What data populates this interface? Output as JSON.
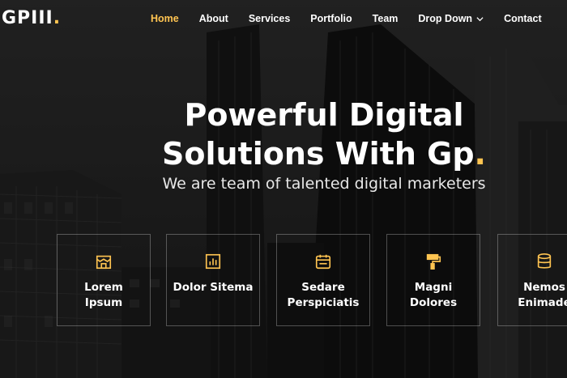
{
  "header": {
    "logo_text": "GPIII",
    "logo_dot": ".",
    "accent_color": "#ffc451",
    "nav": [
      {
        "label": "Home",
        "active": true
      },
      {
        "label": "About"
      },
      {
        "label": "Services"
      },
      {
        "label": "Portfolio"
      },
      {
        "label": "Team"
      },
      {
        "label": "Drop Down",
        "icon": "chevron-down-icon"
      },
      {
        "label": "Contact"
      }
    ]
  },
  "hero": {
    "title_line1": "Powerful Digital",
    "title_line2": "Solutions With Gp",
    "title_dot": ".",
    "subtitle": "We are team of talented digital marketers"
  },
  "features": [
    {
      "title_line1": "Lorem",
      "title_line2": "Ipsum",
      "icon": "store-icon"
    },
    {
      "title_line1": "Dolor Sitema",
      "title_line2": "",
      "icon": "bar-chart-icon"
    },
    {
      "title_line1": "Sedare",
      "title_line2": "Perspiciatis",
      "icon": "calendar-icon"
    },
    {
      "title_line1": "Magni",
      "title_line2": "Dolores",
      "icon": "paint-roller-icon"
    },
    {
      "title_line1": "Nemos",
      "title_line2": "Enimade",
      "icon": "database-icon"
    }
  ]
}
